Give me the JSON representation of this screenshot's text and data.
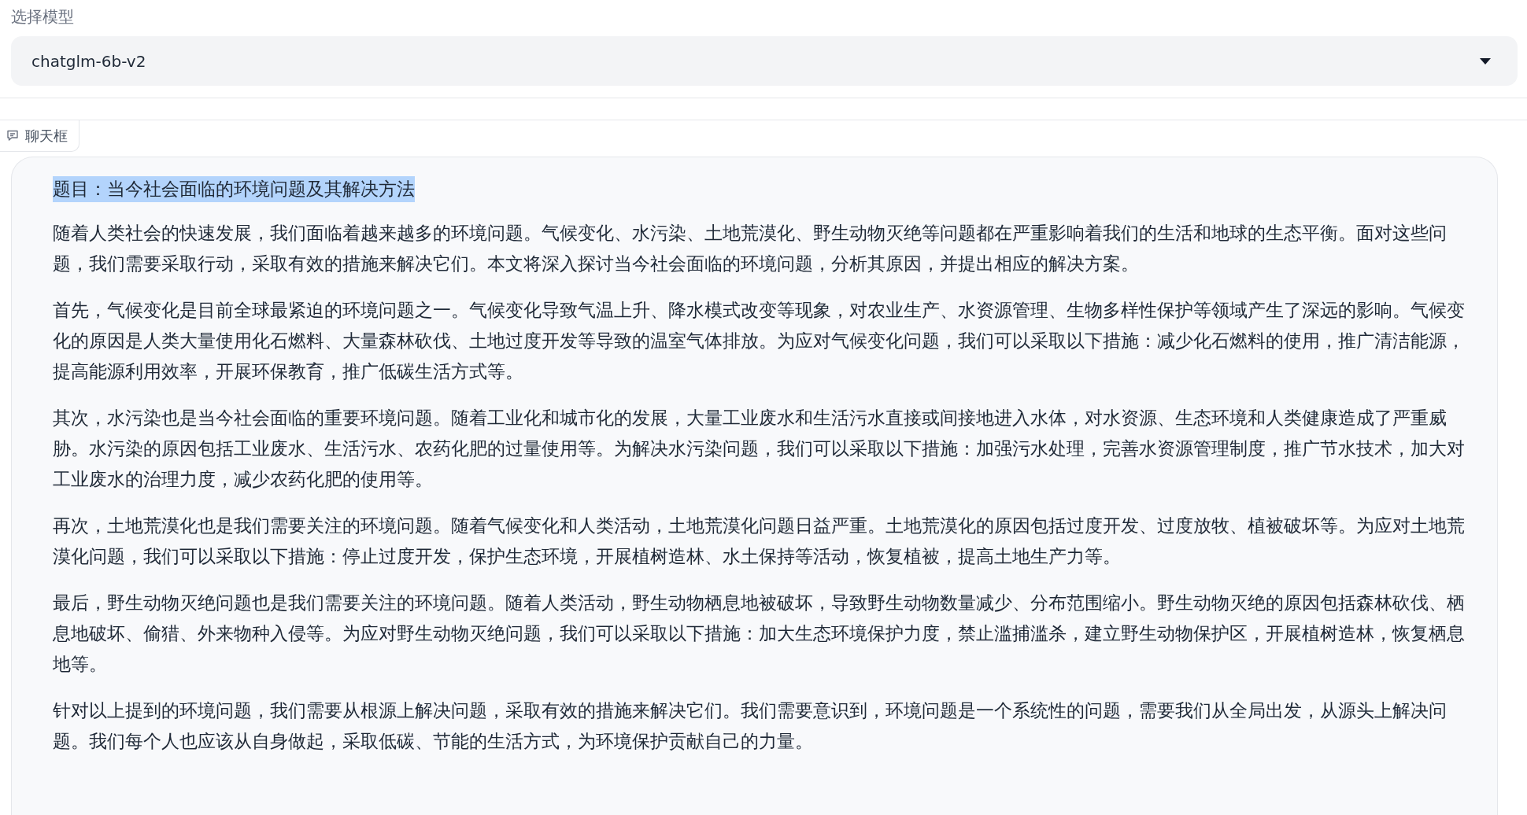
{
  "model_select": {
    "label": "选择模型",
    "value": "chatglm-6b-v2"
  },
  "chatbot": {
    "label": "聊天框",
    "title": {
      "text": "题目：当今社会面临的环境问题及其解决方法",
      "highlighted": true
    },
    "paragraphs": [
      "随着人类社会的快速发展，我们面临着越来越多的环境问题。气候变化、水污染、土地荒漠化、野生动物灭绝等问题都在严重影响着我们的生活和地球的生态平衡。面对这些问题，我们需要采取行动，采取有效的措施来解决它们。本文将深入探讨当今社会面临的环境问题，分析其原因，并提出相应的解决方案。",
      "首先，气候变化是目前全球最紧迫的环境问题之一。气候变化导致气温上升、降水模式改变等现象，对农业生产、水资源管理、生物多样性保护等领域产生了深远的影响。气候变化的原因是人类大量使用化石燃料、大量森林砍伐、土地过度开发等导致的温室气体排放。为应对气候变化问题，我们可以采取以下措施：减少化石燃料的使用，推广清洁能源，提高能源利用效率，开展环保教育，推广低碳生活方式等。",
      "其次，水污染也是当今社会面临的重要环境问题。随着工业化和城市化的发展，大量工业废水和生活污水直接或间接地进入水体，对水资源、生态环境和人类健康造成了严重威胁。水污染的原因包括工业废水、生活污水、农药化肥的过量使用等。为解决水污染问题，我们可以采取以下措施：加强污水处理，完善水资源管理制度，推广节水技术，加大对工业废水的治理力度，减少农药化肥的使用等。",
      "再次，土地荒漠化也是我们需要关注的环境问题。随着气候变化和人类活动，土地荒漠化问题日益严重。土地荒漠化的原因包括过度开发、过度放牧、植被破坏等。为应对土地荒漠化问题，我们可以采取以下措施：停止过度开发，保护生态环境，开展植树造林、水土保持等活动，恢复植被，提高土地生产力等。",
      "最后，野生动物灭绝问题也是我们需要关注的环境问题。随着人类活动，野生动物栖息地被破坏，导致野生动物数量减少、分布范围缩小。野生动物灭绝的原因包括森林砍伐、栖息地破坏、偷猎、外来物种入侵等。为应对野生动物灭绝问题，我们可以采取以下措施：加大生态环境保护力度，禁止滥捕滥杀，建立野生动物保护区，开展植树造林，恢复栖息地等。",
      "针对以上提到的环境问题，我们需要从根源上解决问题，采取有效的措施来解决它们。我们需要意识到，环境问题是一个系统性的问题，需要我们从全局出发，从源头上解决问题。我们每个人也应该从自身做起，采取低碳、节能的生活方式，为环境保护贡献自己的力量。"
    ]
  }
}
